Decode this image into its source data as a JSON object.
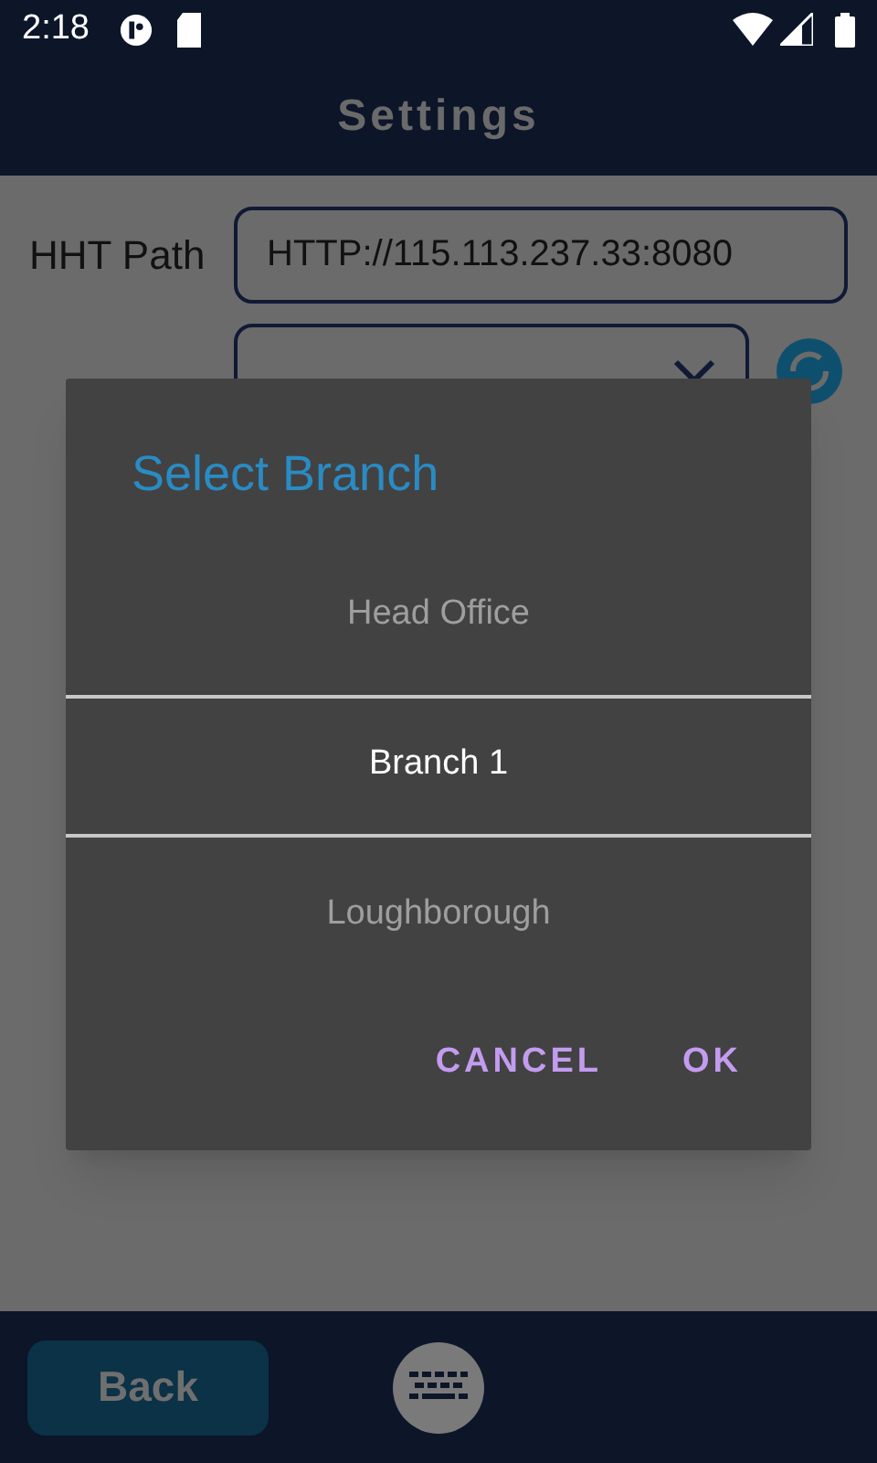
{
  "status_bar": {
    "time": "2:18"
  },
  "header": {
    "title": "Settings"
  },
  "form": {
    "hht_path": {
      "label": "HHT Path",
      "value": "HTTP://115.113.237.33:8080"
    }
  },
  "dialog": {
    "title": "Select Branch",
    "options": [
      {
        "label": "Head Office",
        "selected": false
      },
      {
        "label": "Branch 1",
        "selected": true
      },
      {
        "label": "Loughborough",
        "selected": false
      }
    ],
    "buttons": [
      "CANCEL",
      "OK"
    ]
  },
  "footer": {
    "back": "Back"
  }
}
